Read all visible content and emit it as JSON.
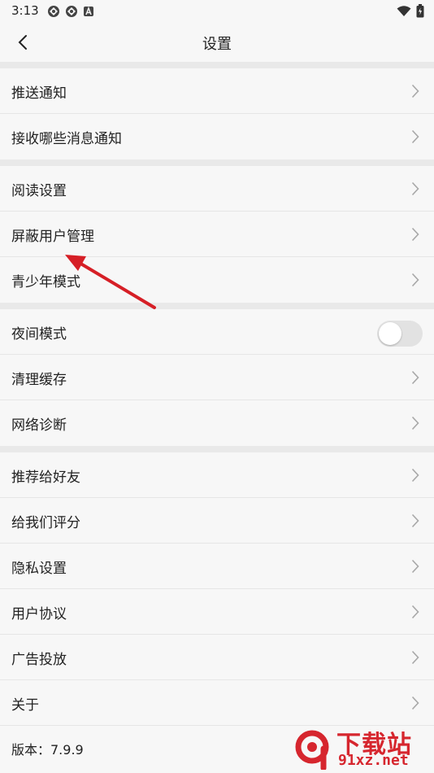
{
  "status_bar": {
    "time": "3:13"
  },
  "header": {
    "title": "设置"
  },
  "sections": [
    {
      "items": [
        {
          "label": "推送通知"
        },
        {
          "label": "接收哪些消息通知"
        }
      ]
    },
    {
      "items": [
        {
          "label": "阅读设置"
        },
        {
          "label": "屏蔽用户管理"
        },
        {
          "label": "青少年模式"
        }
      ]
    },
    {
      "items": [
        {
          "label": "夜间模式",
          "toggle": false
        },
        {
          "label": "清理缓存"
        },
        {
          "label": "网络诊断"
        }
      ]
    },
    {
      "items": [
        {
          "label": "推荐给好友"
        },
        {
          "label": "给我们评分"
        },
        {
          "label": "隐私设置"
        },
        {
          "label": "用户协议"
        },
        {
          "label": "广告投放"
        },
        {
          "label": "关于"
        }
      ]
    }
  ],
  "version_text": "版本：7.9.9",
  "watermark": {
    "text": "下载站",
    "url": "91xz.net"
  },
  "colors": {
    "background": "#f7f7f7",
    "divider": "#e9e9e9",
    "annotation": "#d61f26"
  }
}
